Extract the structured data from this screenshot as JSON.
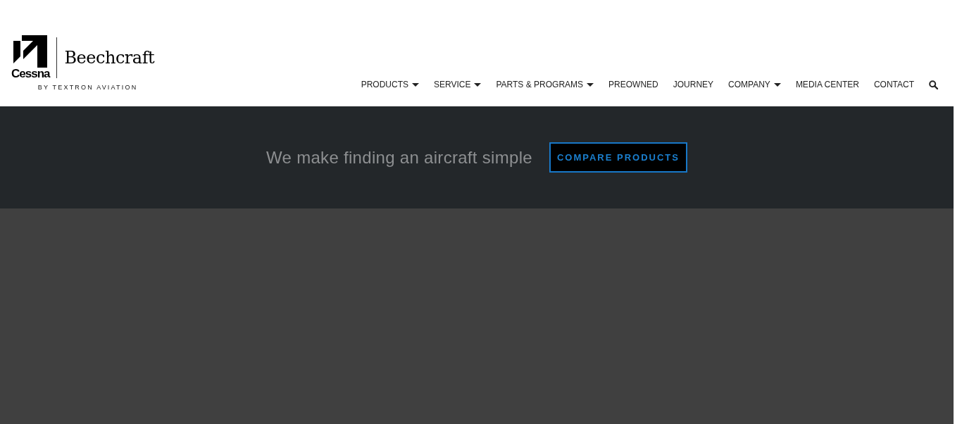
{
  "logo": {
    "brand_left": "Cessna",
    "brand_right": "Beechcraft",
    "tagline": "BY TEXTRON AVIATION"
  },
  "nav": [
    {
      "label": "PRODUCTS",
      "dropdown": true
    },
    {
      "label": "SERVICE",
      "dropdown": true
    },
    {
      "label": "PARTS & PROGRAMS",
      "dropdown": true
    },
    {
      "label": "PREOWNED",
      "dropdown": false
    },
    {
      "label": "JOURNEY",
      "dropdown": false
    },
    {
      "label": "COMPANY",
      "dropdown": true
    },
    {
      "label": "MEDIA CENTER",
      "dropdown": false
    },
    {
      "label": "CONTACT",
      "dropdown": false
    }
  ],
  "banner": {
    "text": "We make finding an aircraft simple",
    "button": "COMPARE PRODUCTS"
  }
}
